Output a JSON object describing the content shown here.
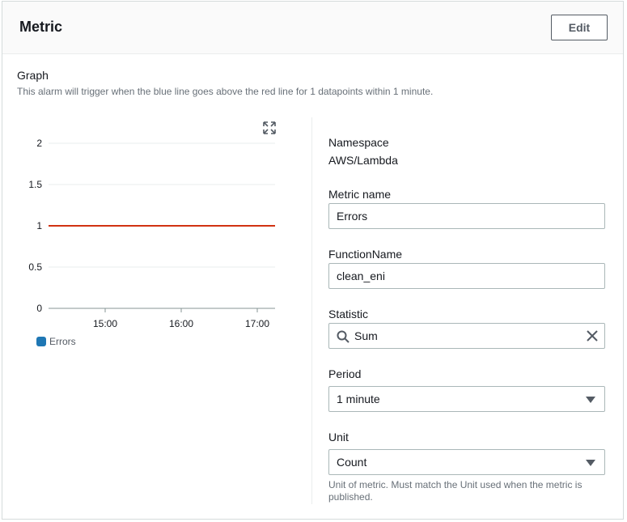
{
  "header": {
    "title": "Metric",
    "edit_label": "Edit"
  },
  "graph": {
    "title": "Graph",
    "description": "This alarm will trigger when the blue line goes above the red line for 1 datapoints within 1 minute."
  },
  "chart_data": {
    "type": "line",
    "y_ticks": [
      "2",
      "1.5",
      "1",
      "0.5",
      "0"
    ],
    "x_ticks": [
      "15:00",
      "16:00",
      "17:00"
    ],
    "ylim": [
      0,
      2
    ],
    "grid": true,
    "threshold": {
      "value": 1,
      "color": "#d13212"
    },
    "series": [
      {
        "name": "Errors",
        "color": "#1f77b4",
        "values": []
      }
    ],
    "legend_position": "bottom-left"
  },
  "form": {
    "namespace_label": "Namespace",
    "namespace_value": "AWS/Lambda",
    "metric_name_label": "Metric name",
    "metric_name_value": "Errors",
    "function_name_label": "FunctionName",
    "function_name_value": "clean_eni",
    "statistic_label": "Statistic",
    "statistic_value": "Sum",
    "period_label": "Period",
    "period_value": "1 minute",
    "unit_label": "Unit",
    "unit_value": "Count",
    "unit_hint": "Unit of metric. Must match the Unit used when the metric is published."
  },
  "icons": {
    "expand": "expand-icon",
    "search": "search-icon",
    "clear": "close-icon",
    "dropdown": "caret-down-icon"
  }
}
